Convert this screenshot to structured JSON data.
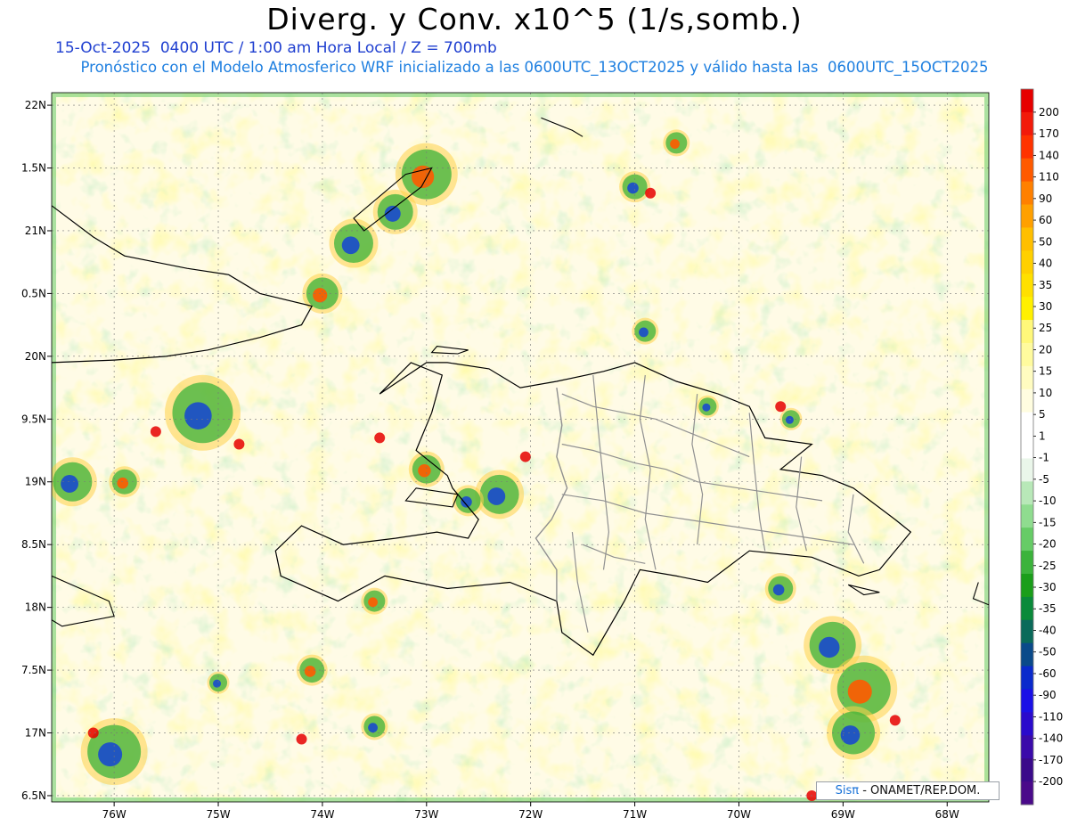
{
  "title": "Diverg. y Conv. x10^5 (1/s,somb.)",
  "subtitle": "15-Oct-2025  0400 UTC / 1:00 am Hora Local / Z = 700mb",
  "info": "Pronóstico con el Modelo Atmosferico WRF inicializado a las 0600UTC_13OCT2025 y válido hasta las  0600UTC_15OCT2025",
  "map": {
    "lon_range": [
      -76.6,
      -67.6
    ],
    "lat_range": [
      16.45,
      22.1
    ],
    "lat_ticks": [
      {
        "value": 22.0,
        "label": "22N"
      },
      {
        "value": 21.5,
        "label": "1.5N"
      },
      {
        "value": 21.0,
        "label": "21N"
      },
      {
        "value": 20.5,
        "label": "0.5N"
      },
      {
        "value": 20.0,
        "label": "20N"
      },
      {
        "value": 19.5,
        "label": "9.5N"
      },
      {
        "value": 19.0,
        "label": "19N"
      },
      {
        "value": 18.5,
        "label": "8.5N"
      },
      {
        "value": 18.0,
        "label": "18N"
      },
      {
        "value": 17.5,
        "label": "7.5N"
      },
      {
        "value": 17.0,
        "label": "17N"
      },
      {
        "value": 16.5,
        "label": "6.5N"
      }
    ],
    "lon_ticks": [
      {
        "value": -76,
        "label": "76W"
      },
      {
        "value": -75,
        "label": "75W"
      },
      {
        "value": -74,
        "label": "74W"
      },
      {
        "value": -73,
        "label": "73W"
      },
      {
        "value": -72,
        "label": "72W"
      },
      {
        "value": -71,
        "label": "71W"
      },
      {
        "value": -70,
        "label": "70W"
      },
      {
        "value": -69,
        "label": "69W"
      },
      {
        "value": -68,
        "label": "68W"
      }
    ]
  },
  "colorbar": {
    "labels": [
      "200",
      "170",
      "140",
      "110",
      "90",
      "60",
      "50",
      "40",
      "35",
      "30",
      "25",
      "20",
      "15",
      "10",
      "5",
      "1",
      "-1",
      "-5",
      "-10",
      "-15",
      "-20",
      "-25",
      "-30",
      "-35",
      "-40",
      "-50",
      "-60",
      "-90",
      "-110",
      "-140",
      "-170",
      "-200"
    ],
    "colors": [
      "#e60000",
      "#f21a0a",
      "#ff3300",
      "#ff5a00",
      "#ff8000",
      "#ffa000",
      "#ffbf00",
      "#ffd000",
      "#ffe000",
      "#fff000",
      "#fff87a",
      "#fffb9e",
      "#fffcc0",
      "#fffde0",
      "#ffffff",
      "#ffffff",
      "#eaf6ea",
      "#b8e8b8",
      "#8fdc8f",
      "#66cc66",
      "#3bb33b",
      "#1a9e1a",
      "#0a8a3a",
      "#0a6a5a",
      "#0a4a8a",
      "#0a2acc",
      "#1a10e6",
      "#2a0acc",
      "#3a0aaa",
      "#3a0a8a",
      "#4a0a8a"
    ]
  },
  "credit": {
    "brand": "Sisπ",
    "org": "- ONAMET/REP.DOM."
  },
  "colors": {
    "convergence_strong": "#0a2acc",
    "convergence": "#3bb33b",
    "divergence": "#fff000",
    "divergence_strong": "#e60000",
    "coastline": "#000000",
    "provinces": "#909090"
  }
}
